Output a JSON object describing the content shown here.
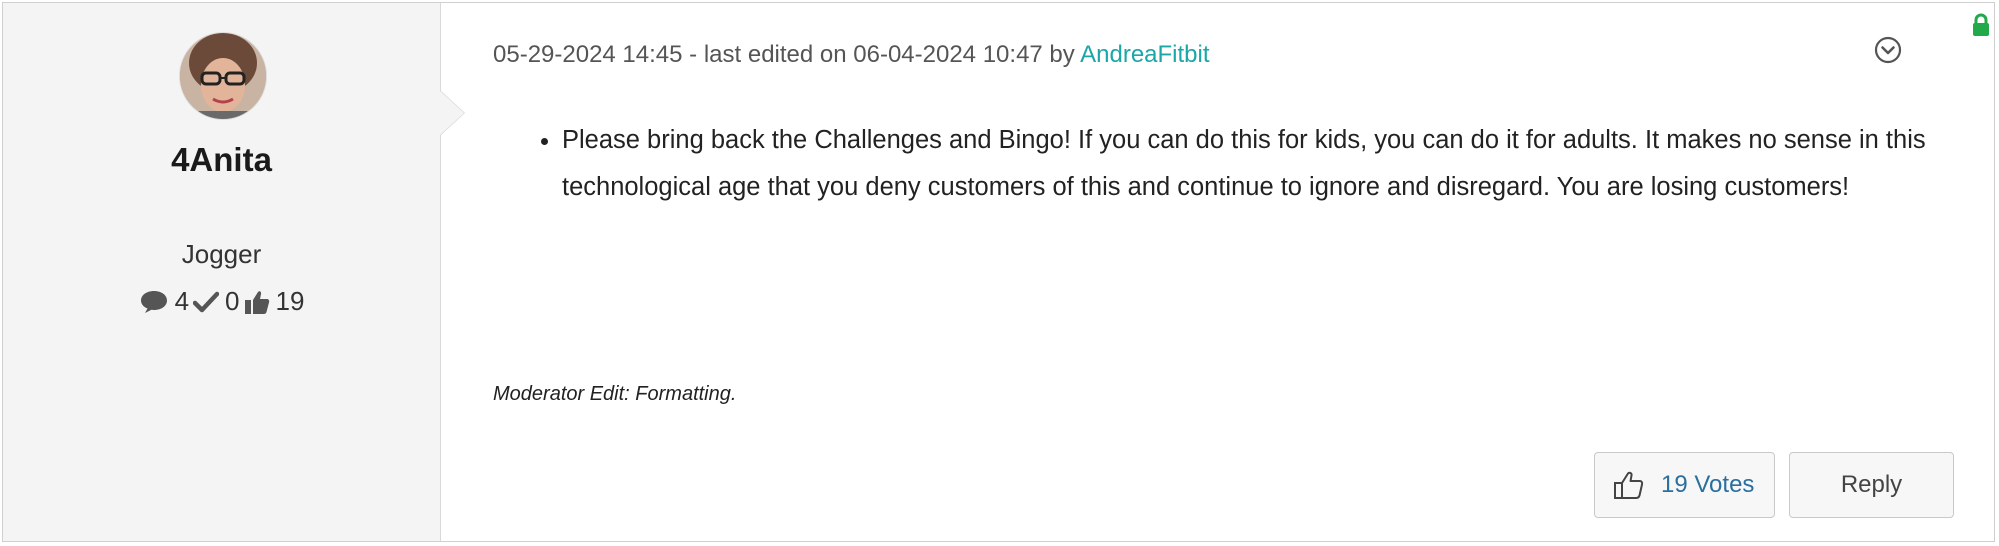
{
  "author": {
    "username": "4Anita",
    "rank": "Jogger",
    "stats": {
      "posts": "4",
      "solutions": "0",
      "kudos": "19"
    }
  },
  "post": {
    "date": "05-29-2024 14:45",
    "edited_text": " - last edited on 06-04-2024 10:47 by ",
    "editor": "AndreaFitbit",
    "body_items": [
      "Please bring back the Challenges and Bingo! If you can do this for kids, you can do it for adults. It makes no sense in this technological age that you deny customers of this and continue to ignore and disregard. You are losing customers!"
    ],
    "moderator_note": "Moderator Edit: Formatting."
  },
  "actions": {
    "votes_label": "19 Votes",
    "reply_label": "Reply"
  },
  "icons": {
    "posts": "speech-bubble-icon",
    "solutions": "checkmark-icon",
    "kudos": "thumbs-up-icon",
    "options": "chevron-down-circle-icon",
    "lock": "lock-icon",
    "vote": "thumbs-up-outline-icon"
  },
  "colors": {
    "author_pane_bg": "#f4f4f4",
    "editor_link": "#1ba6a8",
    "votes_text": "#2a6f9e",
    "lock": "#22a94a"
  }
}
